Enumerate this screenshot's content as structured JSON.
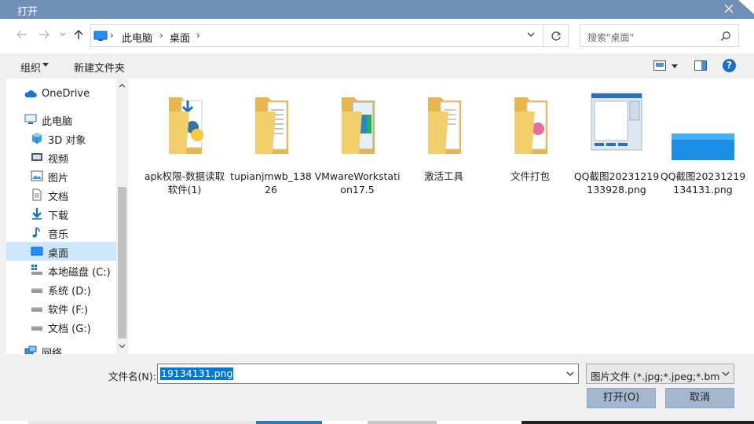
{
  "window": {
    "title": "打开"
  },
  "nav": {
    "crumbs": [
      "此电脑",
      "桌面"
    ],
    "search_placeholder": "搜索\"桌面\""
  },
  "toolbar": {
    "organize": "组织",
    "new_folder": "新建文件夹",
    "help": "?"
  },
  "sidebar": {
    "items": [
      {
        "label": "OneDrive",
        "icon": "cloud-icon"
      },
      {
        "label": "此电脑",
        "icon": "computer-icon"
      },
      {
        "label": "3D 对象",
        "icon": "cube-icon"
      },
      {
        "label": "视频",
        "icon": "video-icon"
      },
      {
        "label": "图片",
        "icon": "picture-icon"
      },
      {
        "label": "文档",
        "icon": "document-icon"
      },
      {
        "label": "下载",
        "icon": "download-icon"
      },
      {
        "label": "音乐",
        "icon": "music-icon"
      },
      {
        "label": "桌面",
        "icon": "desktop-icon",
        "selected": true
      },
      {
        "label": "本地磁盘 (C:)",
        "icon": "drive-c-icon"
      },
      {
        "label": "系统 (D:)",
        "icon": "drive-icon"
      },
      {
        "label": "软件 (F:)",
        "icon": "drive-icon"
      },
      {
        "label": "文档 (G:)",
        "icon": "drive-icon"
      },
      {
        "label": "网络",
        "icon": "network-icon"
      }
    ]
  },
  "files": [
    {
      "name": "apk权限-数据读取软件(1)",
      "kind": "folder-python"
    },
    {
      "name": "tupianjmwb_13826",
      "kind": "folder-doc"
    },
    {
      "name": "VMwareWorkstation17.5",
      "kind": "folder-winrar"
    },
    {
      "name": "激活工具",
      "kind": "folder-doc"
    },
    {
      "name": "文件打包",
      "kind": "folder-pink"
    },
    {
      "name": "QQ截图20231219133928.png",
      "kind": "image-screenshot"
    },
    {
      "name": "QQ截图20231219134131.png",
      "kind": "image-blue"
    }
  ],
  "bottom": {
    "filename_label": "文件名(N):",
    "filename_value": "19134131.png",
    "filetype_value": "图片文件 (*.jpg;*.jpeg;*.bmp;*",
    "open_label": "打开(O)",
    "cancel_label": "取消"
  },
  "colors": {
    "titlebar": "#6f8fb6",
    "selection": "#cce8ff",
    "highlight": "#0078d7",
    "button": "#a3b8cf"
  }
}
